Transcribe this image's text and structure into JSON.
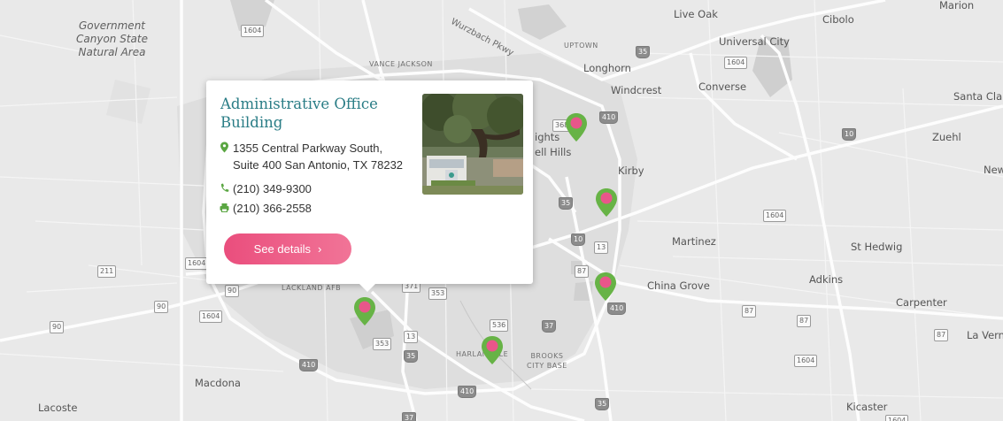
{
  "popup": {
    "title": "Administrative Office Building",
    "address_line1": "1355 Central Parkway South,",
    "address_line2": "Suite 400 San Antonio, TX 78232",
    "phone": "(210) 349-9300",
    "fax": "(210) 366-2558",
    "button_label": "See details",
    "button_chevron": "›"
  },
  "map_labels": {
    "government_canyon": "Government\nCanyon State\nNatural Area",
    "vance_jackson": "VANCE JACKSON",
    "uptown": "UPTOWN",
    "wurzbach": "Wurzbach Pkwy",
    "longhorn": "Longhorn",
    "windcrest": "Windcrest",
    "live_oak": "Live Oak",
    "universal_city": "Universal City",
    "cibolo": "Cibolo",
    "marion": "Marion",
    "converse": "Converse",
    "santa_clara": "Santa Clara",
    "zuehl": "Zuehl",
    "new": "New",
    "kirby": "Kirby",
    "martinez": "Martinez",
    "st_hedwig": "St Hedwig",
    "adkins": "Adkins",
    "china_grove": "China Grove",
    "carpenter": "Carpenter",
    "la_vernia": "La Verni",
    "kicaster": "Kicaster",
    "macdona": "Macdona",
    "lacoste": "Lacoste",
    "lackland": "LACKLAND AFB",
    "harlandale": "HARLANDALE",
    "brooks": "BROOKS\nCITY BASE",
    "heights": "ights",
    "ell_hills": "ell Hills"
  },
  "shields": [
    "1604",
    "1604",
    "1604",
    "1604",
    "1604",
    "1604",
    "1604",
    "211",
    "90",
    "90",
    "90",
    "410",
    "410",
    "410",
    "410",
    "410",
    "10",
    "10",
    "10",
    "35",
    "35",
    "35",
    "35",
    "37",
    "37",
    "13",
    "13",
    "87",
    "87",
    "87",
    "87",
    "353",
    "353",
    "371",
    "536",
    "368"
  ],
  "colors": {
    "pin_green": "#67b346",
    "pin_pink": "#e8568a",
    "title_teal": "#2a7d86",
    "button_start": "#ea4e7d",
    "button_end": "#f17497",
    "icon_green": "#5aa642"
  },
  "icons": {
    "address": "map-marker-icon",
    "phone": "phone-icon",
    "fax": "fax-icon"
  }
}
